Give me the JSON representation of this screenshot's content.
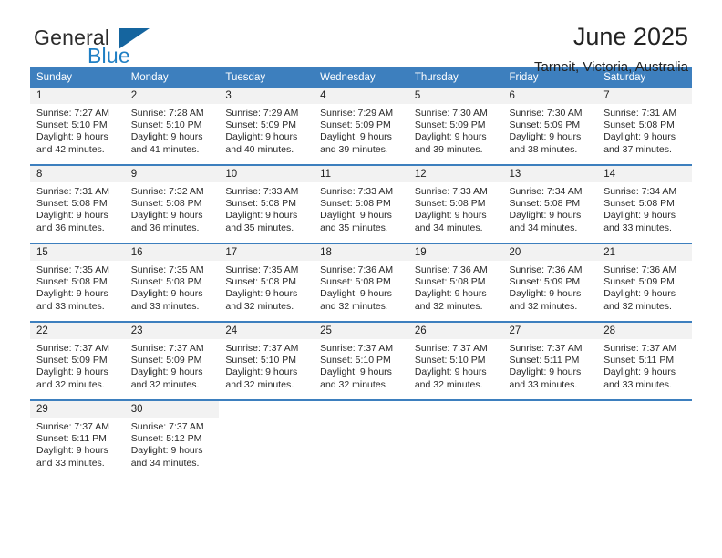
{
  "brand": {
    "name_part1": "General",
    "name_part2": "Blue",
    "accent_color": "#1f7fc4",
    "triangle_color": "#15659f"
  },
  "header": {
    "title": "June 2025",
    "subtitle": "Tarneit, Victoria, Australia",
    "header_bg_color": "#3d7fbe",
    "daynum_bg_color": "#f2f2f2"
  },
  "columns": [
    "Sunday",
    "Monday",
    "Tuesday",
    "Wednesday",
    "Thursday",
    "Friday",
    "Saturday"
  ],
  "weeks": [
    [
      {
        "day": "1",
        "sunrise": "Sunrise: 7:27 AM",
        "sunset": "Sunset: 5:10 PM",
        "daylight1": "Daylight: 9 hours",
        "daylight2": "and 42 minutes."
      },
      {
        "day": "2",
        "sunrise": "Sunrise: 7:28 AM",
        "sunset": "Sunset: 5:10 PM",
        "daylight1": "Daylight: 9 hours",
        "daylight2": "and 41 minutes."
      },
      {
        "day": "3",
        "sunrise": "Sunrise: 7:29 AM",
        "sunset": "Sunset: 5:09 PM",
        "daylight1": "Daylight: 9 hours",
        "daylight2": "and 40 minutes."
      },
      {
        "day": "4",
        "sunrise": "Sunrise: 7:29 AM",
        "sunset": "Sunset: 5:09 PM",
        "daylight1": "Daylight: 9 hours",
        "daylight2": "and 39 minutes."
      },
      {
        "day": "5",
        "sunrise": "Sunrise: 7:30 AM",
        "sunset": "Sunset: 5:09 PM",
        "daylight1": "Daylight: 9 hours",
        "daylight2": "and 39 minutes."
      },
      {
        "day": "6",
        "sunrise": "Sunrise: 7:30 AM",
        "sunset": "Sunset: 5:09 PM",
        "daylight1": "Daylight: 9 hours",
        "daylight2": "and 38 minutes."
      },
      {
        "day": "7",
        "sunrise": "Sunrise: 7:31 AM",
        "sunset": "Sunset: 5:08 PM",
        "daylight1": "Daylight: 9 hours",
        "daylight2": "and 37 minutes."
      }
    ],
    [
      {
        "day": "8",
        "sunrise": "Sunrise: 7:31 AM",
        "sunset": "Sunset: 5:08 PM",
        "daylight1": "Daylight: 9 hours",
        "daylight2": "and 36 minutes."
      },
      {
        "day": "9",
        "sunrise": "Sunrise: 7:32 AM",
        "sunset": "Sunset: 5:08 PM",
        "daylight1": "Daylight: 9 hours",
        "daylight2": "and 36 minutes."
      },
      {
        "day": "10",
        "sunrise": "Sunrise: 7:33 AM",
        "sunset": "Sunset: 5:08 PM",
        "daylight1": "Daylight: 9 hours",
        "daylight2": "and 35 minutes."
      },
      {
        "day": "11",
        "sunrise": "Sunrise: 7:33 AM",
        "sunset": "Sunset: 5:08 PM",
        "daylight1": "Daylight: 9 hours",
        "daylight2": "and 35 minutes."
      },
      {
        "day": "12",
        "sunrise": "Sunrise: 7:33 AM",
        "sunset": "Sunset: 5:08 PM",
        "daylight1": "Daylight: 9 hours",
        "daylight2": "and 34 minutes."
      },
      {
        "day": "13",
        "sunrise": "Sunrise: 7:34 AM",
        "sunset": "Sunset: 5:08 PM",
        "daylight1": "Daylight: 9 hours",
        "daylight2": "and 34 minutes."
      },
      {
        "day": "14",
        "sunrise": "Sunrise: 7:34 AM",
        "sunset": "Sunset: 5:08 PM",
        "daylight1": "Daylight: 9 hours",
        "daylight2": "and 33 minutes."
      }
    ],
    [
      {
        "day": "15",
        "sunrise": "Sunrise: 7:35 AM",
        "sunset": "Sunset: 5:08 PM",
        "daylight1": "Daylight: 9 hours",
        "daylight2": "and 33 minutes."
      },
      {
        "day": "16",
        "sunrise": "Sunrise: 7:35 AM",
        "sunset": "Sunset: 5:08 PM",
        "daylight1": "Daylight: 9 hours",
        "daylight2": "and 33 minutes."
      },
      {
        "day": "17",
        "sunrise": "Sunrise: 7:35 AM",
        "sunset": "Sunset: 5:08 PM",
        "daylight1": "Daylight: 9 hours",
        "daylight2": "and 32 minutes."
      },
      {
        "day": "18",
        "sunrise": "Sunrise: 7:36 AM",
        "sunset": "Sunset: 5:08 PM",
        "daylight1": "Daylight: 9 hours",
        "daylight2": "and 32 minutes."
      },
      {
        "day": "19",
        "sunrise": "Sunrise: 7:36 AM",
        "sunset": "Sunset: 5:08 PM",
        "daylight1": "Daylight: 9 hours",
        "daylight2": "and 32 minutes."
      },
      {
        "day": "20",
        "sunrise": "Sunrise: 7:36 AM",
        "sunset": "Sunset: 5:09 PM",
        "daylight1": "Daylight: 9 hours",
        "daylight2": "and 32 minutes."
      },
      {
        "day": "21",
        "sunrise": "Sunrise: 7:36 AM",
        "sunset": "Sunset: 5:09 PM",
        "daylight1": "Daylight: 9 hours",
        "daylight2": "and 32 minutes."
      }
    ],
    [
      {
        "day": "22",
        "sunrise": "Sunrise: 7:37 AM",
        "sunset": "Sunset: 5:09 PM",
        "daylight1": "Daylight: 9 hours",
        "daylight2": "and 32 minutes."
      },
      {
        "day": "23",
        "sunrise": "Sunrise: 7:37 AM",
        "sunset": "Sunset: 5:09 PM",
        "daylight1": "Daylight: 9 hours",
        "daylight2": "and 32 minutes."
      },
      {
        "day": "24",
        "sunrise": "Sunrise: 7:37 AM",
        "sunset": "Sunset: 5:10 PM",
        "daylight1": "Daylight: 9 hours",
        "daylight2": "and 32 minutes."
      },
      {
        "day": "25",
        "sunrise": "Sunrise: 7:37 AM",
        "sunset": "Sunset: 5:10 PM",
        "daylight1": "Daylight: 9 hours",
        "daylight2": "and 32 minutes."
      },
      {
        "day": "26",
        "sunrise": "Sunrise: 7:37 AM",
        "sunset": "Sunset: 5:10 PM",
        "daylight1": "Daylight: 9 hours",
        "daylight2": "and 32 minutes."
      },
      {
        "day": "27",
        "sunrise": "Sunrise: 7:37 AM",
        "sunset": "Sunset: 5:11 PM",
        "daylight1": "Daylight: 9 hours",
        "daylight2": "and 33 minutes."
      },
      {
        "day": "28",
        "sunrise": "Sunrise: 7:37 AM",
        "sunset": "Sunset: 5:11 PM",
        "daylight1": "Daylight: 9 hours",
        "daylight2": "and 33 minutes."
      }
    ],
    [
      {
        "day": "29",
        "sunrise": "Sunrise: 7:37 AM",
        "sunset": "Sunset: 5:11 PM",
        "daylight1": "Daylight: 9 hours",
        "daylight2": "and 33 minutes."
      },
      {
        "day": "30",
        "sunrise": "Sunrise: 7:37 AM",
        "sunset": "Sunset: 5:12 PM",
        "daylight1": "Daylight: 9 hours",
        "daylight2": "and 34 minutes."
      },
      {
        "day": "",
        "sunrise": "",
        "sunset": "",
        "daylight1": "",
        "daylight2": ""
      },
      {
        "day": "",
        "sunrise": "",
        "sunset": "",
        "daylight1": "",
        "daylight2": ""
      },
      {
        "day": "",
        "sunrise": "",
        "sunset": "",
        "daylight1": "",
        "daylight2": ""
      },
      {
        "day": "",
        "sunrise": "",
        "sunset": "",
        "daylight1": "",
        "daylight2": ""
      },
      {
        "day": "",
        "sunrise": "",
        "sunset": "",
        "daylight1": "",
        "daylight2": ""
      }
    ]
  ]
}
